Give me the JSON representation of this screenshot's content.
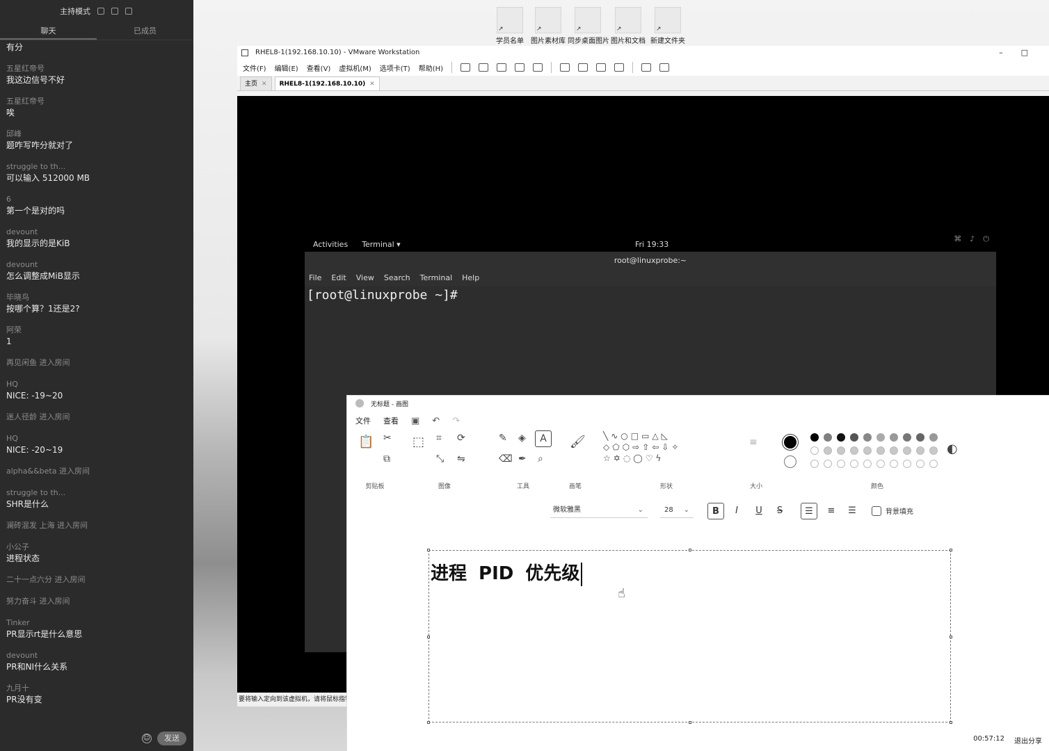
{
  "chat": {
    "mode_title": "主持模式",
    "tabs": [
      "聊天",
      "已成员"
    ],
    "messages": [
      {
        "type": "msg",
        "who": "",
        "text": "有分"
      },
      {
        "type": "msg",
        "who": "五星红帝号",
        "text": "我这边信号不好"
      },
      {
        "type": "msg",
        "who": "五星红帝号",
        "text": "唉"
      },
      {
        "type": "msg",
        "who": "邱峰",
        "text": "题咋写咋分就对了"
      },
      {
        "type": "msg",
        "who": "struggle to th...",
        "text": "可以输入 512000 MB"
      },
      {
        "type": "msg",
        "who": "6",
        "text": "第一个是对的吗"
      },
      {
        "type": "msg",
        "who": "devount",
        "text": "我的显示的是KiB"
      },
      {
        "type": "msg",
        "who": "devount",
        "text": "怎么调整成MiB显示"
      },
      {
        "type": "msg",
        "who": "毕晓鸟",
        "text": "按哪个算？1还是2?"
      },
      {
        "type": "msg",
        "who": "阿荣",
        "text": "1"
      },
      {
        "type": "sys",
        "text": "再见闲鱼 进入房间"
      },
      {
        "type": "msg",
        "who": "HQ",
        "text": "NICE: -19~20"
      },
      {
        "type": "sys",
        "text": "迷人径龄 进入房间"
      },
      {
        "type": "msg",
        "who": "HQ",
        "text": "NICE: -20~19"
      },
      {
        "type": "sys",
        "text": "alpha&&beta 进入房间"
      },
      {
        "type": "msg",
        "who": "struggle to th...",
        "text": "SHR是什么"
      },
      {
        "type": "sys",
        "text": "澜砖混发 上海 进入房间"
      },
      {
        "type": "msg",
        "who": "小公子",
        "text": "进程状态"
      },
      {
        "type": "sys",
        "text": "二十一点六分 进入房间"
      },
      {
        "type": "sys",
        "text": "努力奋斗 进入房间"
      },
      {
        "type": "msg",
        "who": "Tinker",
        "text": "PR显示rt是什么意思"
      },
      {
        "type": "msg",
        "who": "devount",
        "text": "PR和NI什么关系"
      },
      {
        "type": "msg",
        "who": "九月十",
        "text": "PR没有变"
      }
    ],
    "send_label": "发送"
  },
  "desktop_icons": [
    "学员名单",
    "图片素材库",
    "同步桌面图片",
    "图片和文档",
    "新建文件夹"
  ],
  "vmware": {
    "title": "RHEL8-1(192.168.10.10) - VMware Workstation",
    "menu": [
      "文件(F)",
      "编辑(E)",
      "查看(V)",
      "虚拟机(M)",
      "选项卡(T)",
      "帮助(H)"
    ],
    "tabs": [
      {
        "label": "主页",
        "active": false
      },
      {
        "label": "RHEL8-1(192.168.10.10)",
        "active": true
      }
    ],
    "status_text": "要将输入定向到该虚拟机，请将鼠标指针移入其中或按 Ctrl+G。"
  },
  "gnome": {
    "activities": "Activities",
    "app": "Terminal ▾",
    "clock": "Fri 19:33"
  },
  "terminal": {
    "title": "root@linuxprobe:~",
    "menu": [
      "File",
      "Edit",
      "View",
      "Search",
      "Terminal",
      "Help"
    ],
    "prompt": "[root@linuxprobe ~]#"
  },
  "paint": {
    "title": "无标题 - 画图",
    "menu": [
      "文件",
      "查看"
    ],
    "groups": [
      "剪贴板",
      "图像",
      "工具",
      "画笔",
      "形状",
      "大小",
      "颜色"
    ],
    "font": "微软雅黑",
    "size": "28",
    "fill_label": "背景填充",
    "canvas_text": "进程 PID 优先级"
  },
  "share": {
    "timer": "00:57:12",
    "exit": "退出分享"
  }
}
